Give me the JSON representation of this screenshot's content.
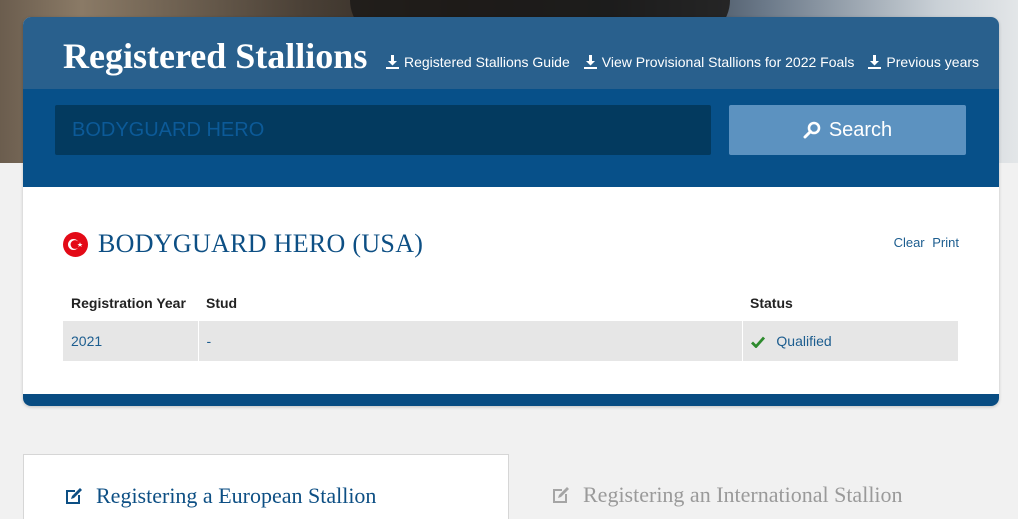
{
  "header": {
    "title": "Registered Stallions",
    "links": [
      {
        "label": "Registered Stallions Guide",
        "icon": "download-icon"
      },
      {
        "label": "View Provisional Stallions for 2022 Foals",
        "icon": "download-icon"
      },
      {
        "label": "Previous years",
        "icon": "download-icon"
      }
    ]
  },
  "search": {
    "value": "BODYGUARD HERO",
    "button_label": "Search",
    "button_icon": "search-icon"
  },
  "result": {
    "flag_icon": "turkey-flag-icon",
    "title": "BODYGUARD HERO (USA)",
    "actions": {
      "clear": "Clear",
      "print": "Print"
    },
    "columns": [
      "Registration Year",
      "Stud",
      "Status"
    ],
    "rows": [
      {
        "year": "2021",
        "stud": "-",
        "status": "Qualified",
        "status_icon": "check-icon"
      }
    ]
  },
  "tabs": [
    {
      "label": "Registering a European Stallion",
      "icon": "edit-icon",
      "active": true
    },
    {
      "label": "Registering an International Stallion",
      "icon": "edit-icon",
      "active": false
    }
  ],
  "colors": {
    "brand_blue": "#0b4a7d",
    "search_button": "#5c92c0",
    "status_green": "#2e8b2e",
    "flag_red": "#e30a17"
  }
}
